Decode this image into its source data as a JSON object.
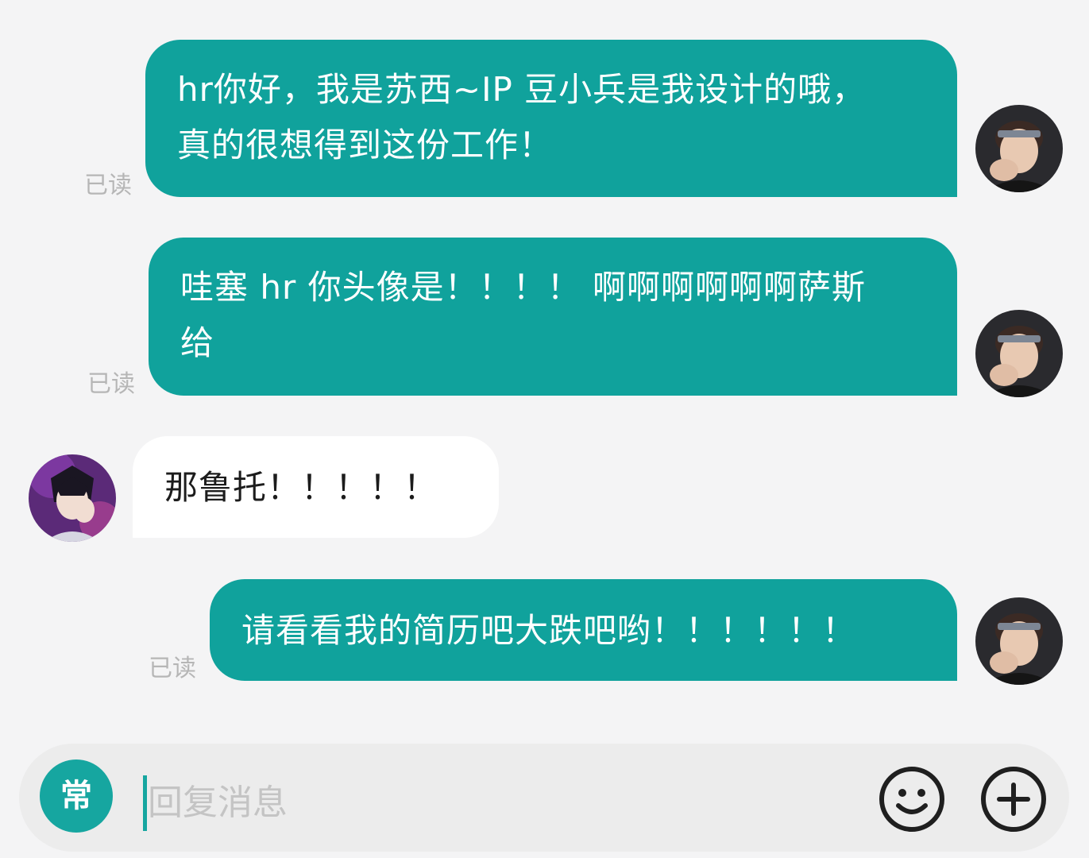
{
  "messages": [
    {
      "side": "me",
      "text_line1": "hr你好，我是苏西~IP 豆小兵是我设计的哦，",
      "text_line2": "真的很想得到这份工作！",
      "status": "已读"
    },
    {
      "side": "me",
      "text_line1": "哇塞 hr 你头像是！！！！ 啊啊啊啊啊啊萨斯",
      "text_line2": "给",
      "status": "已读"
    },
    {
      "side": "them",
      "text_line1": "那鲁托！！！！！"
    },
    {
      "side": "me",
      "text_line1": "请看看我的简历吧大跌吧哟！！！！！！",
      "status": "已读"
    }
  ],
  "input": {
    "quick_label": "常",
    "placeholder": "回复消息",
    "emoji_icon": "smiley-icon",
    "plus_icon": "plus-icon"
  },
  "colors": {
    "accent": "#10a29c",
    "background": "#f4f4f5",
    "incoming_bubble": "#ffffff",
    "read_status": "#b6b6b6"
  }
}
